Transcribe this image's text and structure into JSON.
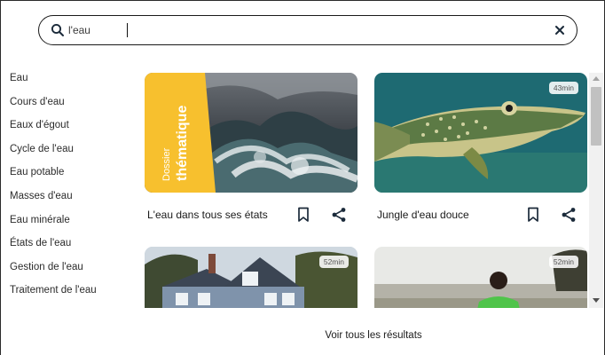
{
  "search": {
    "value": "l'eau",
    "icon": "search-icon",
    "clear_icon": "close-icon"
  },
  "suggestions": [
    "Eau",
    "Cours d'eau",
    "Eaux d'égout",
    "Cycle de l'eau",
    "Eau potable",
    "Masses d'eau",
    "Eau minérale",
    "États de l'eau",
    "Gestion de l'eau",
    "Traitement de l'eau"
  ],
  "results": [
    {
      "title": "L'eau dans tous ses états",
      "badge_line1": "Dossier",
      "badge_line2": "thématique",
      "duration": ""
    },
    {
      "title": "Jungle d'eau douce",
      "duration": "43min"
    },
    {
      "title": "",
      "duration": "52min"
    },
    {
      "title": "",
      "duration": "52min"
    }
  ],
  "footer": {
    "see_all": "Voir tous les résultats"
  },
  "colors": {
    "badge_yellow": "#f7c02e",
    "text": "#1b1b1b"
  }
}
